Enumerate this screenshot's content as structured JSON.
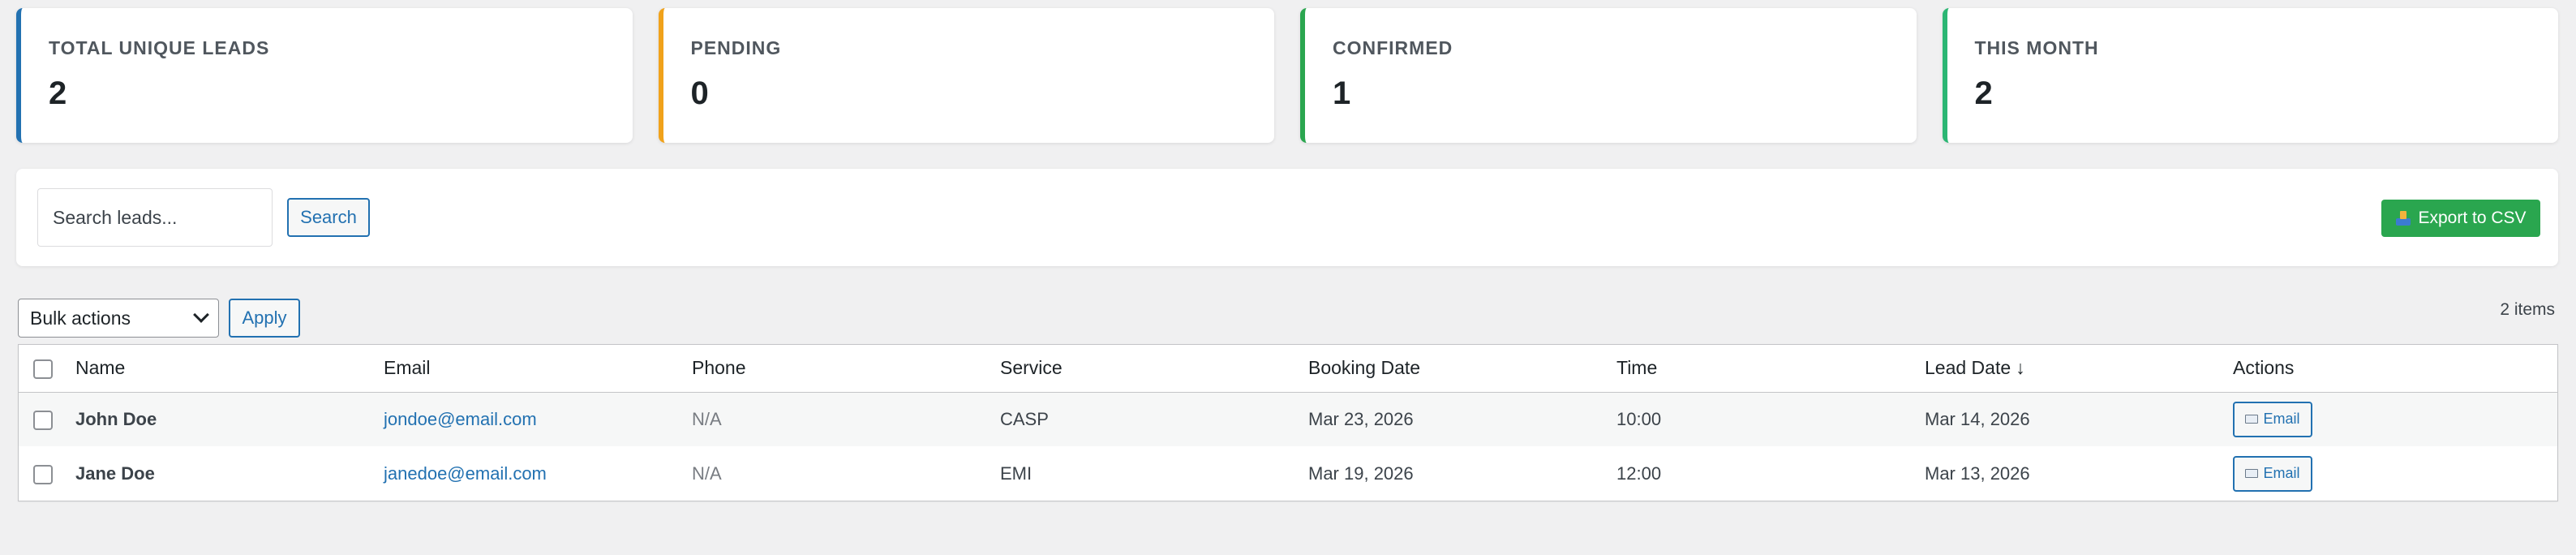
{
  "stats": [
    {
      "label": "TOTAL UNIQUE LEADS",
      "value": "2",
      "accent": "#2271b1"
    },
    {
      "label": "PENDING",
      "value": "0",
      "accent": "#f0a21b"
    },
    {
      "label": "CONFIRMED",
      "value": "1",
      "accent": "#2aa64f"
    },
    {
      "label": "THIS MONTH",
      "value": "2",
      "accent": "#2bb673"
    }
  ],
  "search": {
    "placeholder": "Search leads...",
    "button_label": "Search",
    "export_label": "Export to CSV",
    "export_icon": "inbox-tray-icon"
  },
  "tablenav": {
    "bulk_selected": "Bulk actions",
    "apply_label": "Apply",
    "items_count": "2 items"
  },
  "table": {
    "headers": {
      "name": "Name",
      "email": "Email",
      "phone": "Phone",
      "service": "Service",
      "booking_date": "Booking Date",
      "time": "Time",
      "lead_date": "Lead Date",
      "lead_date_sort": "↓",
      "actions": "Actions"
    },
    "rows": [
      {
        "name": "John Doe",
        "email": "jondoe@email.com",
        "phone": "N/A",
        "service": "CASP",
        "booking_date": "Mar 23, 2026",
        "time": "10:00",
        "lead_date": "Mar 14, 2026",
        "action_label": "Email"
      },
      {
        "name": "Jane Doe",
        "email": "janedoe@email.com",
        "phone": "N/A",
        "service": "EMI",
        "booking_date": "Mar 19, 2026",
        "time": "12:00",
        "lead_date": "Mar 13, 2026",
        "action_label": "Email"
      }
    ]
  },
  "colors": {
    "primary": "#2271b1",
    "export_green": "#2aa64f",
    "background": "#f0f0f1"
  }
}
